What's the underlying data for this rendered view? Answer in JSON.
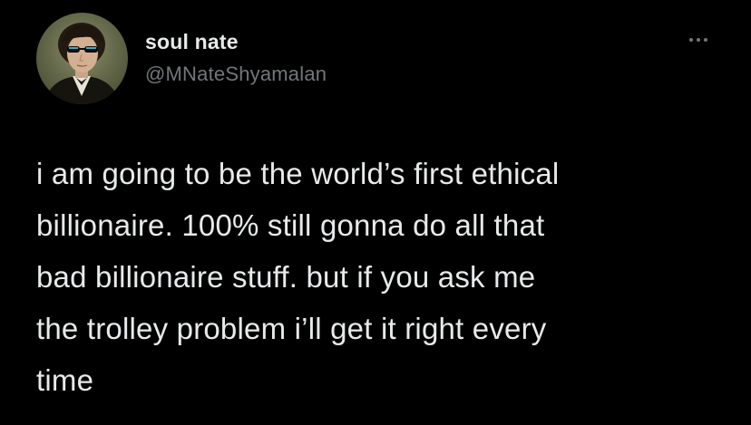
{
  "tweet": {
    "author": {
      "display_name": "soul nate",
      "handle": "@MNateShyamalan",
      "avatar_icon": "portrait-avatar-icon"
    },
    "more_icon": "more-dots-icon",
    "text_lines": [
      "i am going to be the world’s first ethical",
      "billionaire. 100% still gonna do all that",
      "bad billionaire stuff. but if you ask me",
      "the trolley problem i’ll get it right every",
      "time"
    ]
  },
  "colors": {
    "background": "#000000",
    "primary_text": "#e7e9ea",
    "secondary_text": "#71767b"
  }
}
